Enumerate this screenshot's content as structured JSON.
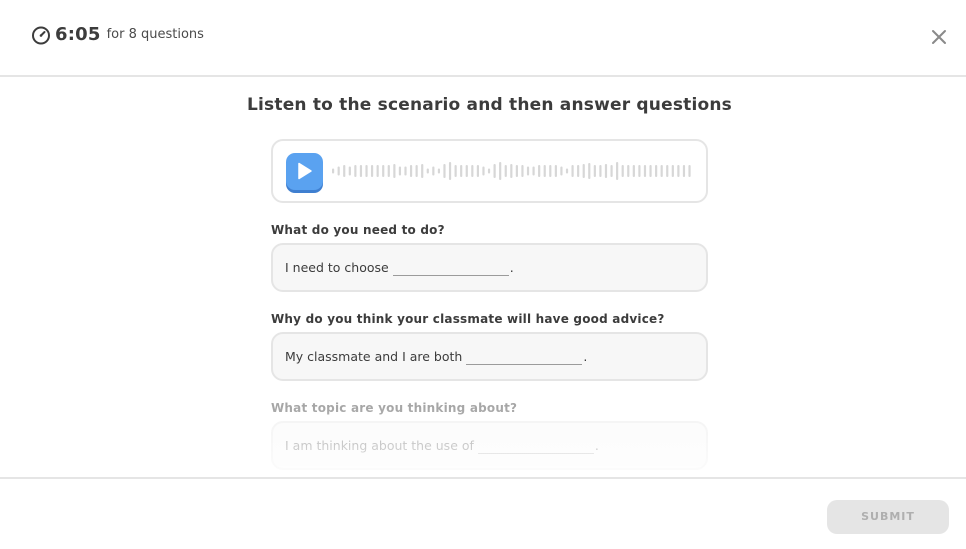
{
  "header": {
    "timer_value": "6:05",
    "timer_text": "for 8 questions",
    "timer_icon": "stopwatch-icon",
    "close_icon": "close-icon"
  },
  "main": {
    "title": "Listen to the scenario and then answer questions",
    "audio": {
      "play_icon": "play-icon",
      "accent_color": "#5aa2f0"
    },
    "questions": [
      {
        "label": "What do you need to do?",
        "prompt": "I need to choose",
        "answer": "",
        "suffix": "."
      },
      {
        "label": "Why do you think your classmate will have good advice?",
        "prompt": "My classmate and I are both",
        "answer": "",
        "suffix": "."
      },
      {
        "label": "What topic are you thinking about?",
        "prompt": "I am thinking about the use of",
        "answer": "",
        "suffix": "."
      }
    ]
  },
  "footer": {
    "submit_label": "SUBMIT"
  }
}
